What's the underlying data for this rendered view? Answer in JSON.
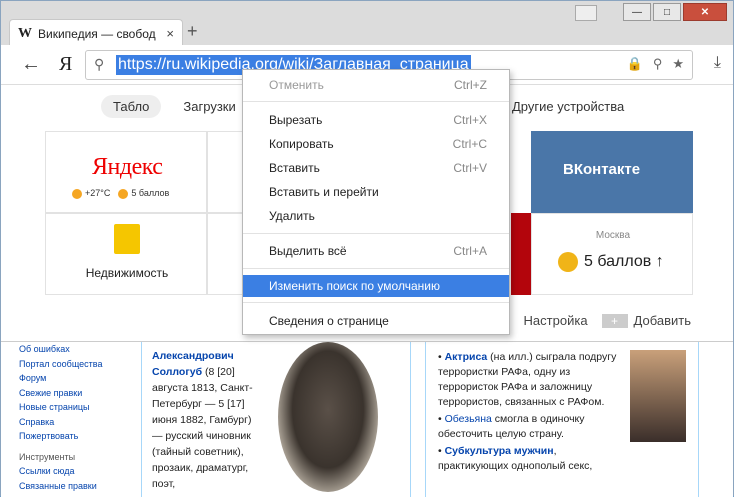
{
  "tab": {
    "favicon": "W",
    "title": "Википедия — свобод",
    "close": "×"
  },
  "newtab": "+",
  "window_buttons": {
    "min": "—",
    "max": "□",
    "close": "✕"
  },
  "toolbar": {
    "back": "←",
    "yandex_logo": "Я",
    "url": "https://ru.wikipedia.org/wiki/Заглавная_страница",
    "download": "⤓",
    "icons": [
      "lock-icon",
      "search-icon",
      "star-icon"
    ]
  },
  "nav": {
    "tablo": "Табло",
    "downloads": "Загрузки",
    "other": "Другие устройства"
  },
  "tiles": {
    "yandex": {
      "name": "Яндекс",
      "temp": "+27°C",
      "score": "5 баллов"
    },
    "nedv": {
      "label": "Недвижимость"
    },
    "vk": {
      "name": "ВКонтакте"
    },
    "moscow": {
      "city": "Москва",
      "score": "5 баллов ↑"
    }
  },
  "bottom": {
    "settings": "Настройка",
    "add": "Добавить",
    "add_icon": "+"
  },
  "context_menu": [
    {
      "label": "Отменить",
      "shortcut": "Ctrl+Z",
      "disabled": true
    },
    {
      "label": "Вырезать",
      "shortcut": "Ctrl+X"
    },
    {
      "label": "Копировать",
      "shortcut": "Ctrl+C"
    },
    {
      "label": "Вставить",
      "shortcut": "Ctrl+V"
    },
    {
      "label": "Вставить и перейти",
      "shortcut": ""
    },
    {
      "label": "Удалить",
      "shortcut": ""
    },
    {
      "label": "Выделить всё",
      "shortcut": "Ctrl+A"
    },
    {
      "label": "Изменить поиск по умолчанию",
      "shortcut": "",
      "highlighted": true
    },
    {
      "label": "Сведения о странице",
      "shortcut": ""
    }
  ],
  "wiki": {
    "sidebar": [
      "Об ошибках",
      "Портал сообщества",
      "Форум",
      "Свежие правки",
      "Новые страницы",
      "Справка",
      "Пожертвовать"
    ],
    "tools_header": "Инструменты",
    "tools": [
      "Ссылки сюда",
      "Связанные правки"
    ],
    "article": {
      "name": "Александрович Соллогуб",
      "text": "(8 [20] августа 1813, Санкт-Петербург — 5 [17] июня 1882, Гамбург) — русский чиновник (тайный советник), прозаик, драматург, поэт,"
    },
    "news": [
      {
        "lead": "Актриса",
        "rest": " (на илл.) сыграла подругу террористки РАФа, одну из террористок РАФа и заложницу террористов, связанных с РАФом."
      },
      {
        "lead": "Обезьяна",
        "rest": " смогла в одиночку обесточить целую страну."
      },
      {
        "lead": "Субкультура мужчин",
        "rest": ", практикующих однополый секс,"
      }
    ]
  },
  "colors": {
    "accent": "#3b7fe3",
    "vk": "#4a76a8",
    "yandex": "#e00000"
  }
}
